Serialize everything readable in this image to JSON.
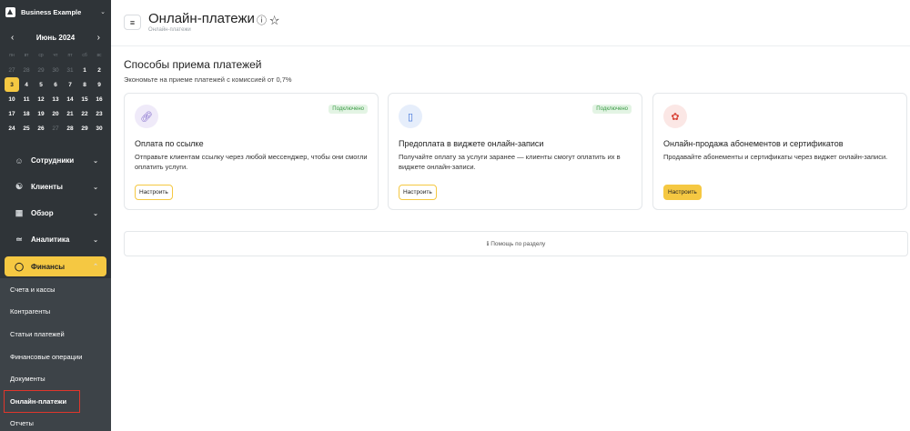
{
  "sidebar": {
    "business_name": "Business Example",
    "calendar": {
      "month": "Июнь 2024",
      "weekdays": [
        "пн",
        "вт",
        "ср",
        "чт",
        "пт",
        "сб",
        "вс"
      ],
      "weeks": [
        [
          "27",
          "28",
          "29",
          "30",
          "31",
          "1",
          "2"
        ],
        [
          "3",
          "4",
          "5",
          "6",
          "7",
          "8",
          "9"
        ],
        [
          "10",
          "11",
          "12",
          "13",
          "14",
          "15",
          "16"
        ],
        [
          "17",
          "18",
          "19",
          "20",
          "21",
          "22",
          "23"
        ],
        [
          "24",
          "25",
          "26",
          "27",
          "28",
          "29",
          "30"
        ]
      ],
      "today": "3"
    },
    "nav": [
      {
        "label": "Сотрудники",
        "icon": "person-icon"
      },
      {
        "label": "Клиенты",
        "icon": "clients-icon"
      },
      {
        "label": "Обзор",
        "icon": "grid-icon"
      },
      {
        "label": "Аналитика",
        "icon": "analytics-icon"
      }
    ],
    "finance": {
      "label": "Финансы",
      "items": [
        "Счета и кассы",
        "Контрагенты",
        "Статьи платежей",
        "Финансовые операции",
        "Документы",
        "Онлайн-платежи",
        "Отчеты"
      ],
      "selected": "Онлайн-платежи"
    }
  },
  "header": {
    "title": "Онлайн-платежи",
    "breadcrumb": "Онлайн-платежи"
  },
  "content": {
    "heading": "Способы приема платежей",
    "subheading": "Экономьте на приеме платежей с комиссией от 0,7%",
    "cards": [
      {
        "icon": "link-icon",
        "badge": "Подключено",
        "title": "Оплата по ссылке",
        "description": "Отправьте клиентам ссылку через любой мессенджер, чтобы они смогли оплатить услуги.",
        "button": "Настроить"
      },
      {
        "icon": "phone-icon",
        "badge": "Подключено",
        "title": "Предоплата в виджете онлайн-записи",
        "description": "Получайте оплату за услуги заранее — клиенты смогут оплатить их в виджете онлайн-записи.",
        "button": "Настроить"
      },
      {
        "icon": "certificate-icon",
        "title": "Онлайн-продажа абонементов и сертификатов",
        "description": "Продавайте абонементы и сертификаты через виджет онлайн-записи.",
        "button": "Настроить"
      }
    ],
    "help": "Помощь по разделу"
  },
  "colors": {
    "sidebar_bg": "#2f3438",
    "accent": "#f5c842",
    "selected_outline": "#e0362c",
    "badge_green": "#3a9a45"
  }
}
